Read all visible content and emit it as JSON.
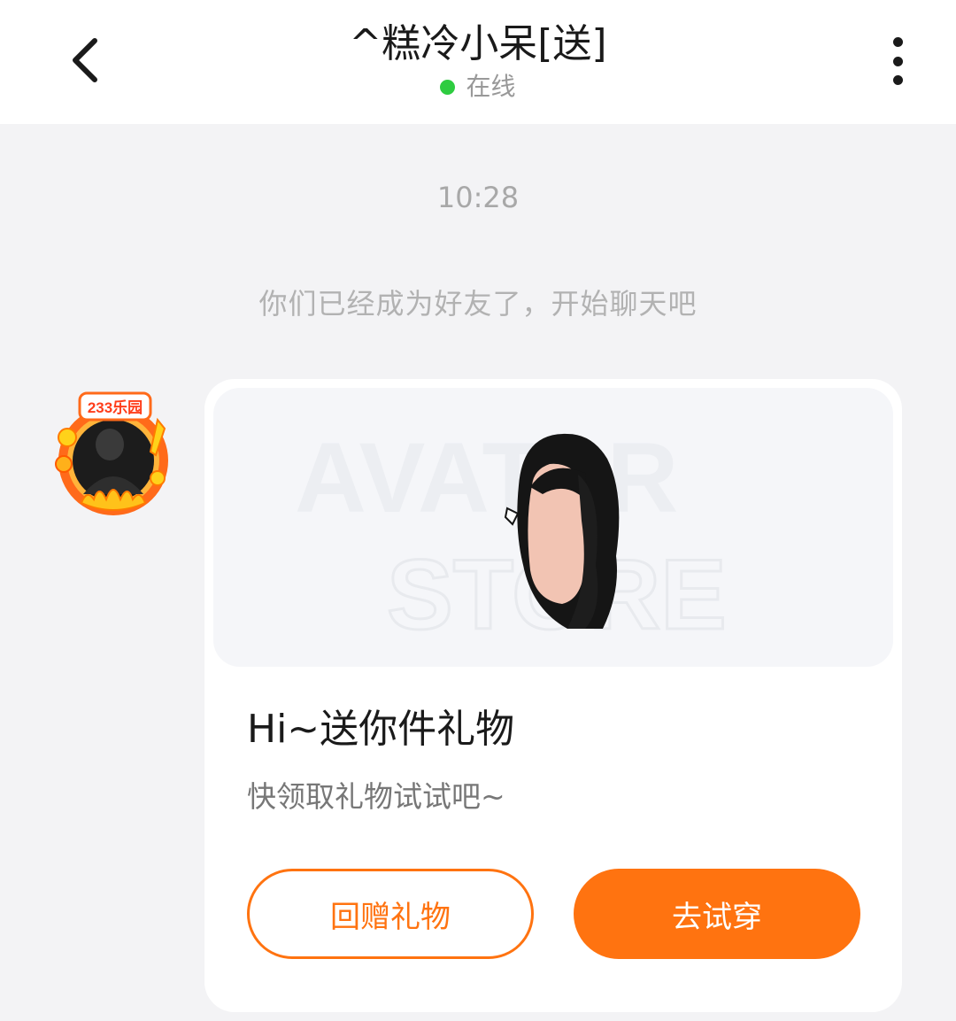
{
  "header": {
    "title": "^糕冷小呆[送]",
    "status": "在线",
    "status_color": "#2ecc40",
    "back_icon": "chevron-left-icon",
    "more_icon": "more-vertical-icon"
  },
  "chat": {
    "timestamp": "10:28",
    "system_message": "你们已经成为好友了，开始聊天吧"
  },
  "avatar": {
    "badge_text": "233乐园",
    "frame_color": "#ff6a1a"
  },
  "gift_card": {
    "image_watermark_line1": "AVATAR",
    "image_watermark_line2": "STORE",
    "title": "Hi~送你件礼物",
    "subtitle": "快领取礼物试试吧~",
    "return_gift_button": "回赠礼物",
    "try_on_button": "去试穿",
    "accent_color": "#ff7310"
  }
}
